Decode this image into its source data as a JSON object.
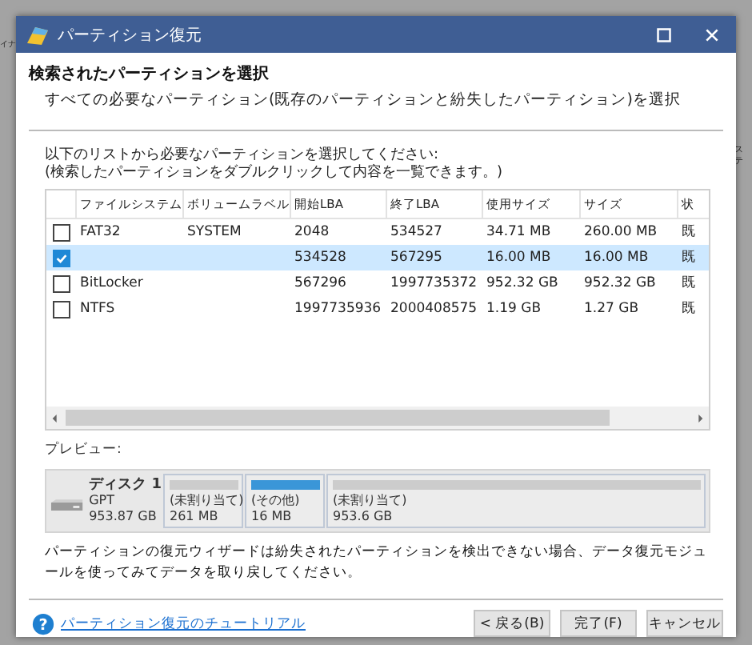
{
  "background_fragments": [
    "イナ",
    "ステ"
  ],
  "window": {
    "title": "パーティション復元"
  },
  "header": {
    "title": "検索されたパーティションを選択",
    "subtitle": "すべての必要なパーティション(既存のパーティションと紛失したパーティション)を選択"
  },
  "instructions": [
    "以下のリストから必要なパーティションを選択してください:",
    "(検索したパーティションをダブルクリックして内容を一覧できます。)"
  ],
  "table": {
    "columns": [
      "ファイルシステム",
      "ボリュームラベル",
      "開始LBA",
      "終了LBA",
      "使用サイズ",
      "サイズ",
      "状"
    ],
    "rows": [
      {
        "checked": false,
        "selected": false,
        "cells": [
          "FAT32",
          "SYSTEM",
          "2048",
          "534527",
          "34.71 MB",
          "260.00 MB",
          "既"
        ]
      },
      {
        "checked": true,
        "selected": true,
        "cells": [
          "",
          "",
          "534528",
          "567295",
          "16.00 MB",
          "16.00 MB",
          "既"
        ]
      },
      {
        "checked": false,
        "selected": false,
        "cells": [
          "BitLocker",
          "",
          "567296",
          "1997735372",
          "952.32 GB",
          "952.32 GB",
          "既"
        ]
      },
      {
        "checked": false,
        "selected": false,
        "cells": [
          "NTFS",
          "",
          "1997735936",
          "2000408575",
          "1.19 GB",
          "1.27 GB",
          "既"
        ]
      }
    ]
  },
  "preview": {
    "label": "プレビュー:",
    "disk": {
      "name": "ディスク 1",
      "type": "GPT",
      "size": "953.87 GB"
    },
    "partitions": [
      {
        "label": "(未割り当て)",
        "size": "261 MB",
        "color": "#cccccc"
      },
      {
        "label": "(その他)",
        "size": "16 MB",
        "color": "#3a96d8"
      },
      {
        "label": "(未割り当て)",
        "size": "953.6 GB",
        "color": "#cccccc"
      }
    ]
  },
  "notice": "パーティションの復元ウィザードは紛失されたパーティションを検出できない場合、データ復元モジュールを使ってみてデータを取り戻してください。",
  "footer": {
    "help_icon": "?",
    "help_link": "パーティション復元のチュートリアル",
    "buttons": [
      "< 戻る(B)",
      "完了(F)",
      "キャンセル"
    ]
  }
}
